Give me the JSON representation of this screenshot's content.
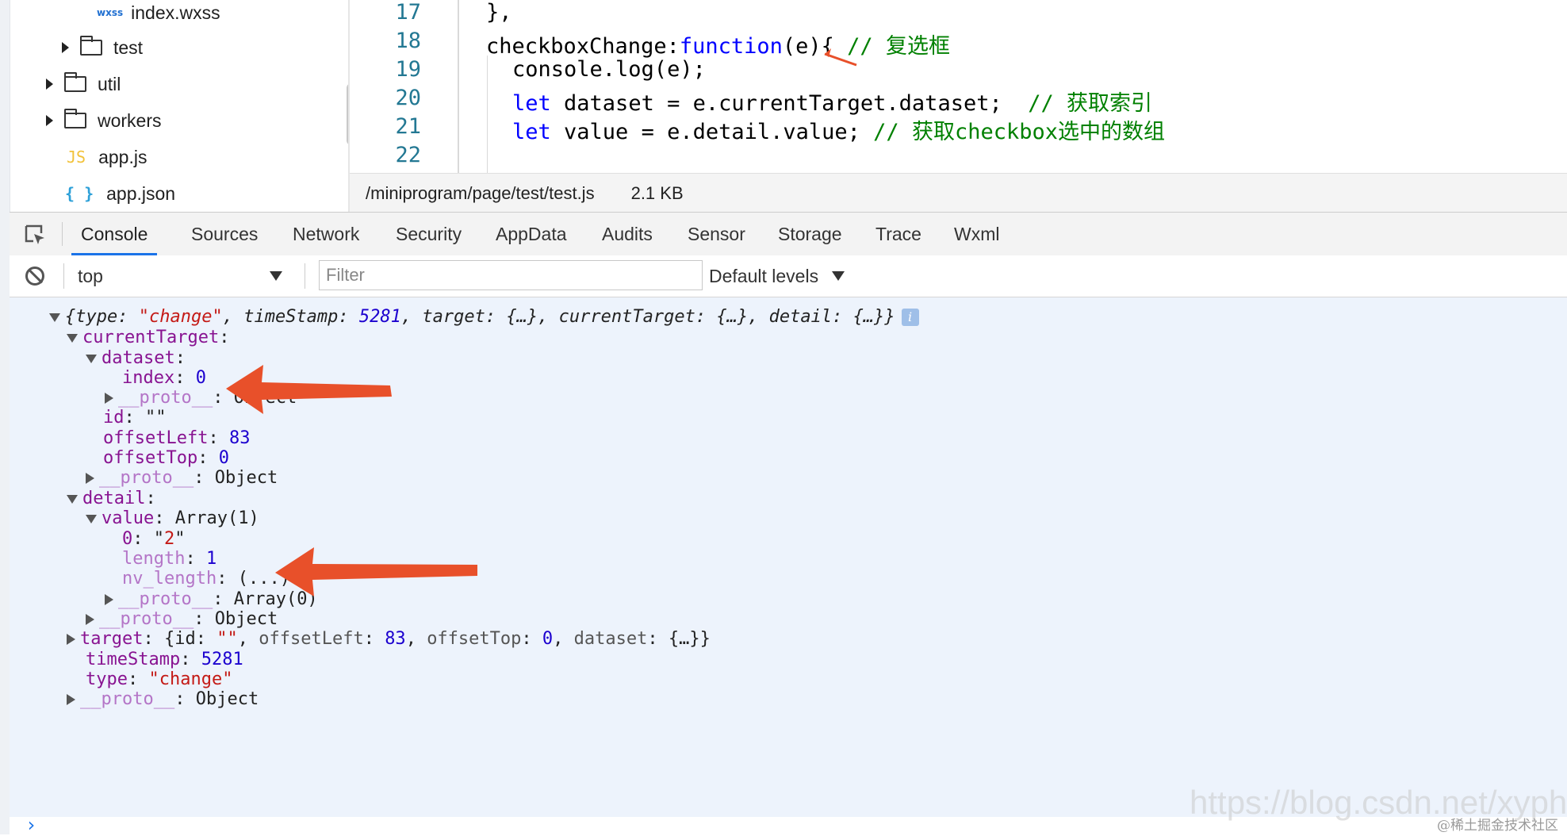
{
  "file_tree": {
    "items": [
      {
        "label": "index.wxss",
        "icon": "wxss-icon",
        "icon_text": "wxss"
      },
      {
        "label": "test",
        "icon": "folder-icon"
      },
      {
        "label": "util",
        "icon": "folder-icon"
      },
      {
        "label": "workers",
        "icon": "folder-icon"
      },
      {
        "label": "app.js",
        "icon": "js-icon",
        "icon_text": "JS"
      },
      {
        "label": "app.json",
        "icon": "json-icon",
        "icon_text": "{ }"
      }
    ]
  },
  "editor": {
    "line_numbers": [
      "17",
      "18",
      "19",
      "20",
      "21",
      "22"
    ],
    "lines": {
      "l17": "},",
      "l18_a": "checkboxChange:",
      "l18_kw": "function",
      "l18_b": "(e){ ",
      "l18_cm": "// 复选框",
      "l19": "console.log(e);",
      "l20_kw": "let",
      "l20_a": " dataset = e.currentTarget.dataset;  ",
      "l20_cm": "// 获取索引",
      "l21_kw": "let",
      "l21_a": " value = e.detail.value; ",
      "l21_cm": "// 获取checkbox选中的数组"
    }
  },
  "status_bar": {
    "path": "/miniprogram/page/test/test.js",
    "size": "2.1 KB"
  },
  "devtools": {
    "tabs": [
      "Console",
      "Sources",
      "Network",
      "Security",
      "AppData",
      "Audits",
      "Sensor",
      "Storage",
      "Trace",
      "Wxml"
    ],
    "active_tab": "Console",
    "context": "top",
    "filter_placeholder": "Filter",
    "levels": "Default levels"
  },
  "console": {
    "summary": {
      "k1": "type",
      "v1": "\"change\"",
      "k2": "timeStamp",
      "v2": "5281",
      "k3": "target",
      "v3": "{…}",
      "k4": "currentTarget",
      "v4": "{…}",
      "k5": "detail",
      "v5": "{…}",
      "info": "i"
    },
    "currentTarget_key": "currentTarget",
    "dataset_key": "dataset",
    "index_key": "index",
    "index_val": "0",
    "proto_key": "__proto__",
    "object_val": "Object",
    "id_key": "id",
    "id_val": "\"\"",
    "offsetLeft_key": "offsetLeft",
    "offsetLeft_val": "83",
    "offsetTop_key": "offsetTop",
    "offsetTop_val": "0",
    "detail_key": "detail",
    "value_key": "value",
    "value_val": "Array(1)",
    "item0_key": "0",
    "item0_val": "\"2\"",
    "length_key": "length",
    "length_val": "1",
    "nvlength_key": "nv_length",
    "nvlength_val": "(...)",
    "array0_val": "Array(0)",
    "target_key": "target",
    "target_preview": {
      "open": "{",
      "k1": "id",
      "v1": "\"\"",
      "k2": "offsetLeft",
      "v2": "83",
      "k3": "offsetTop",
      "v3": "0",
      "k4": "dataset",
      "v4": "{…}",
      "close": "}"
    },
    "timeStamp_key": "timeStamp",
    "timeStamp_val": "5281",
    "type_key": "type",
    "type_val": "\"change\""
  },
  "watermark": "https://blog.csdn.net/xyphf",
  "watermark2": "@稀土掘金技术社区",
  "colors": {
    "annotation_arrow": "#e8502a",
    "active_tab_underline": "#1a73e8",
    "console_bg": "#edf3fc"
  }
}
